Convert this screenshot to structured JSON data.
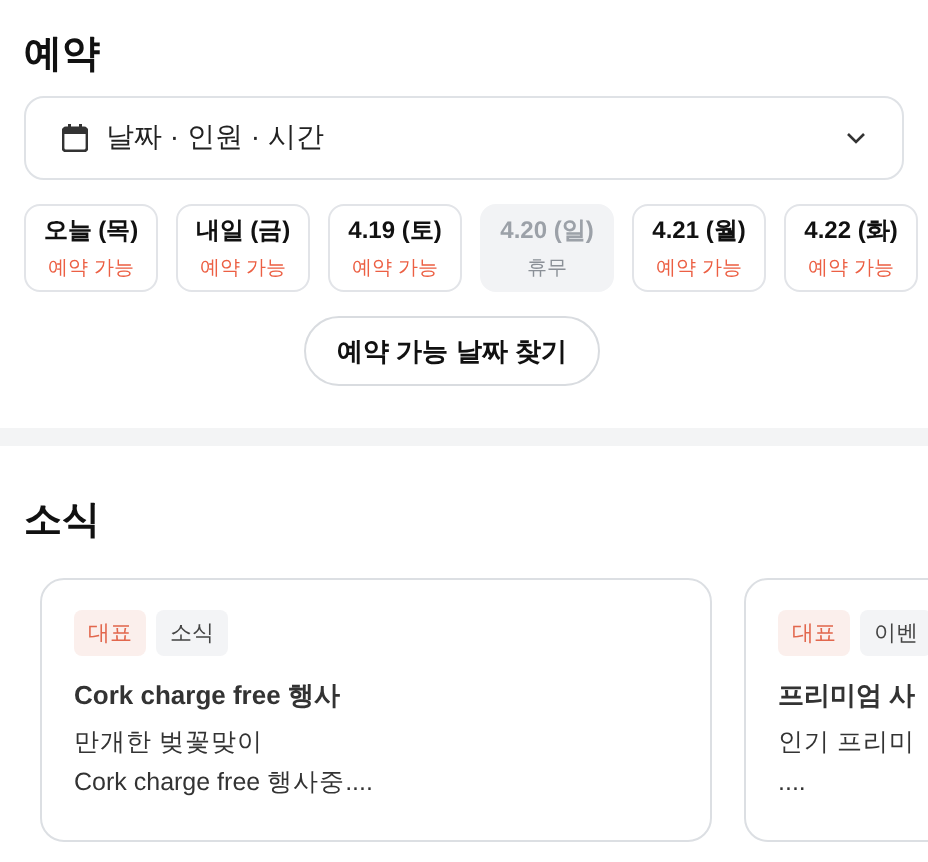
{
  "reservation": {
    "title": "예약",
    "selector": {
      "label": "날짜 · 인원 · 시간"
    },
    "days": [
      {
        "date": "오늘 (목)",
        "status": "예약 가능",
        "available": true
      },
      {
        "date": "내일 (금)",
        "status": "예약 가능",
        "available": true
      },
      {
        "date": "4.19 (토)",
        "status": "예약 가능",
        "available": true
      },
      {
        "date": "4.20 (일)",
        "status": "휴무",
        "available": false
      },
      {
        "date": "4.21 (월)",
        "status": "예약 가능",
        "available": true
      },
      {
        "date": "4.22 (화)",
        "status": "예약 가능",
        "available": true
      }
    ],
    "find_button": "예약 가능 날짜 찾기"
  },
  "news": {
    "title": "소식",
    "cards": [
      {
        "tags": [
          {
            "label": "대표",
            "kind": "main"
          },
          {
            "label": "소식",
            "kind": "plain"
          }
        ],
        "title": "Cork charge free 행사",
        "body": [
          "만개한 벚꽃맞이",
          "Cork charge free 행사중...."
        ]
      },
      {
        "tags": [
          {
            "label": "대표",
            "kind": "main"
          },
          {
            "label": "이벤",
            "kind": "plain"
          }
        ],
        "title": "프리미엄 사",
        "body": [
          "인기 프리미",
          "...."
        ]
      }
    ]
  }
}
